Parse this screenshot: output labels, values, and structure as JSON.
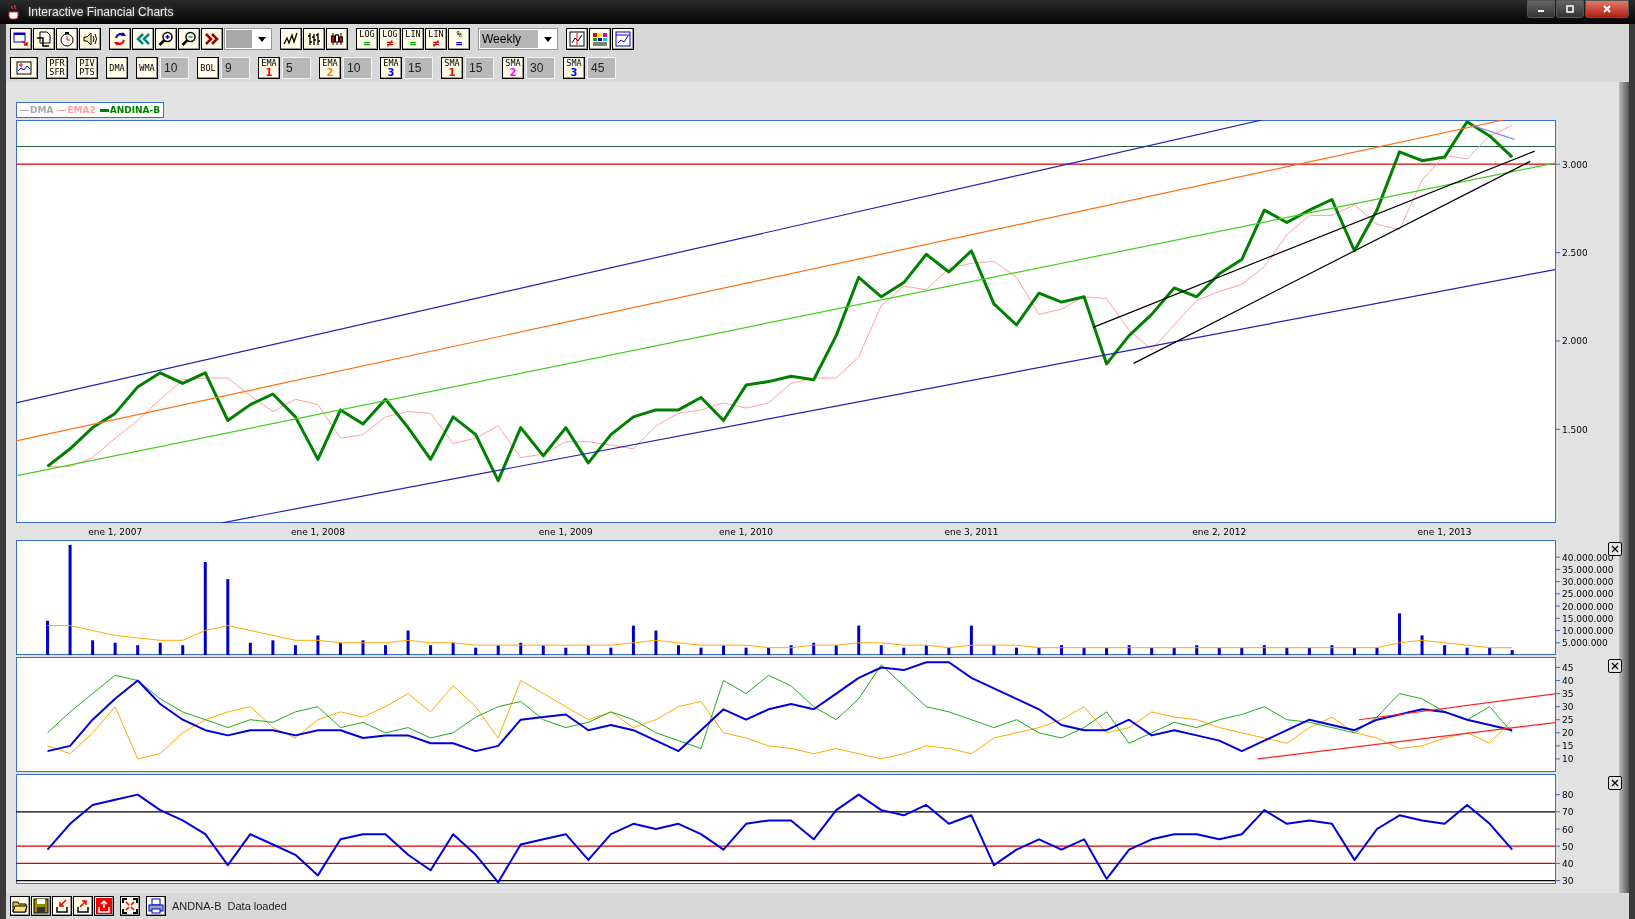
{
  "window": {
    "title": "Interactive Financial Charts"
  },
  "toolbar": {
    "interval": "Weekly",
    "scale_buttons": [
      {
        "label": "LOG",
        "sign": "=",
        "color": "#00a000"
      },
      {
        "label": "LOG",
        "sign": "≠",
        "color": "#e00000"
      },
      {
        "label": "LIN",
        "sign": "=",
        "color": "#00a000"
      },
      {
        "label": "LIN",
        "sign": "≠",
        "color": "#e00000"
      },
      {
        "label": "%",
        "sign": "=",
        "color": "#0000ff"
      }
    ]
  },
  "indicator_bar": {
    "buttons": [
      {
        "kind": "pair",
        "label": "PFR",
        "sub": "SFR"
      },
      {
        "kind": "pair",
        "label": "PIV",
        "sub": "PTS"
      },
      {
        "kind": "single",
        "label": "DMA"
      },
      {
        "kind": "single",
        "label": "WMA",
        "value": "10"
      },
      {
        "kind": "single",
        "label": "BOL",
        "value": "9"
      },
      {
        "kind": "numbered",
        "label": "EMA",
        "sub": "1",
        "color": "#ff0000",
        "value": "5"
      },
      {
        "kind": "numbered",
        "label": "EMA",
        "sub": "2",
        "color": "#ff8000",
        "value": "10"
      },
      {
        "kind": "numbered",
        "label": "EMA",
        "sub": "3",
        "color": "#0000ff",
        "value": "15"
      },
      {
        "kind": "numbered",
        "label": "SMA",
        "sub": "1",
        "color": "#ff0000",
        "value": "15"
      },
      {
        "kind": "numbered",
        "label": "SMA",
        "sub": "2",
        "color": "#ff00ff",
        "value": "30"
      },
      {
        "kind": "numbered",
        "label": "SMA",
        "sub": "3",
        "color": "#0000ff",
        "value": "45"
      }
    ]
  },
  "legend": [
    {
      "label": "DMA",
      "color": "#a8a8a8"
    },
    {
      "label": "EMA2",
      "color": "#ffa0a0"
    },
    {
      "label": "ANDINA-B",
      "color": "#008000"
    }
  ],
  "panels": [
    {
      "closable": false,
      "chart_data": {
        "type": "line",
        "ylim": [
          970,
          3250
        ],
        "categories": [
          null,
          null,
          null,
          "ene 1, 2007",
          null,
          null,
          null,
          null,
          null,
          null,
          null,
          null,
          "ene 1, 2008",
          null,
          null,
          null,
          null,
          null,
          null,
          null,
          null,
          null,
          null,
          "ene 1, 2009",
          null,
          null,
          null,
          null,
          null,
          null,
          null,
          "ene 1, 2010",
          null,
          null,
          null,
          null,
          null,
          null,
          null,
          null,
          null,
          "ene 3, 2011",
          null,
          null,
          null,
          null,
          null,
          null,
          null,
          null,
          null,
          null,
          "ene 2, 2012",
          null,
          null,
          null,
          null,
          null,
          null,
          null,
          null,
          null,
          "ene 1, 2013",
          null,
          null,
          null
        ],
        "yticks": [
          {
            "value": 3000,
            "label": "3.000"
          },
          {
            "value": 2500,
            "label": "2.500"
          },
          {
            "value": 2000,
            "label": "2.000"
          },
          {
            "value": 1500,
            "label": "1.500"
          }
        ],
        "series": [
          {
            "color": "#ffa0a0",
            "values": [
              1290,
              1290,
              1340,
              1450,
              1550,
              1670,
              1780,
              1790,
              1790,
              1690,
              1600,
              1670,
              1640,
              1450,
              1470,
              1570,
              1600,
              1590,
              1420,
              1450,
              1520,
              1340,
              1360,
              1430,
              1430,
              1410,
              1390,
              1520,
              1590,
              1610,
              1650,
              1620,
              1650,
              1760,
              1790,
              1790,
              1910,
              2200,
              2310,
              2290,
              2410,
              2440,
              2450,
              2360,
              2150,
              2180,
              2250,
              2240,
              2060,
              1950,
              2090,
              2230,
              2280,
              2320,
              2420,
              2600,
              2710,
              2710,
              2770,
              2660,
              2630,
              2910,
              3050,
              3030,
              3160,
              3220
            ]
          },
          {
            "color": "#008000",
            "values": [
              1290,
              1390,
              1510,
              1590,
              1740,
              1820,
              1760,
              1820,
              1550,
              1640,
              1700,
              1570,
              1330,
              1610,
              1530,
              1670,
              1510,
              1330,
              1570,
              1470,
              1210,
              1510,
              1350,
              1510,
              1310,
              1470,
              1570,
              1610,
              1610,
              1680,
              1550,
              1750,
              1770,
              1800,
              1780,
              2030,
              2360,
              2250,
              2330,
              2490,
              2390,
              2510,
              2210,
              2090,
              2270,
              2220,
              2250,
              1870,
              2030,
              2150,
              2300,
              2250,
              2380,
              2460,
              2740,
              2670,
              2740,
              2800,
              2510,
              2740,
              3070,
              3020,
              3040,
              3240,
              3160,
              3040
            ]
          }
        ],
        "ref_lines": [
          {
            "axis": "y",
            "value": 3100
          },
          {
            "axis": "y",
            "value": 3000
          }
        ]
      }
    },
    {
      "closable": true,
      "chart_data": {
        "type": "bar",
        "ylim": [
          0,
          47000000
        ],
        "categories": [
          null,
          null,
          null,
          null,
          null,
          null,
          null,
          null,
          null,
          null,
          null,
          null,
          null,
          null,
          null,
          null,
          null,
          null,
          null,
          null,
          null,
          null,
          null,
          null,
          null,
          null,
          null,
          null,
          null,
          null,
          null,
          null,
          null,
          null,
          null,
          null,
          null,
          null,
          null,
          null,
          null,
          null,
          null,
          null,
          null,
          null,
          null,
          null,
          null,
          null,
          null,
          null,
          null,
          null,
          null,
          null,
          null,
          null,
          null,
          null,
          null,
          null,
          null,
          null,
          null,
          null
        ],
        "yticks": [
          {
            "value": 40000000,
            "label": "40.000.000"
          },
          {
            "value": 35000000,
            "label": "35.000.000"
          },
          {
            "value": 30000000,
            "label": "30.000.000"
          },
          {
            "value": 25000000,
            "label": "25.000.000"
          },
          {
            "value": 20000000,
            "label": "20.000.000"
          },
          {
            "value": 15000000,
            "label": "15.000.000"
          },
          {
            "value": 10000000,
            "label": "10.000.000"
          },
          {
            "value": 5000000,
            "label": "5.000.000"
          }
        ],
        "series": [
          {
            "color": "#0000cc",
            "values": [
              14000000,
              45000000,
              6000000,
              5000000,
              4000000,
              5000000,
              4000000,
              38000000,
              31000000,
              5000000,
              6000000,
              4000000,
              8000000,
              5000000,
              6000000,
              4000000,
              10000000,
              4000000,
              5000000,
              3000000,
              4000000,
              5000000,
              4000000,
              3000000,
              4000000,
              3000000,
              12000000,
              10000000,
              4000000,
              3000000,
              4000000,
              3000000,
              3000000,
              4000000,
              5000000,
              4000000,
              12000000,
              4000000,
              3000000,
              4000000,
              3000000,
              12000000,
              4000000,
              3000000,
              3000000,
              4000000,
              3000000,
              3000000,
              4000000,
              3000000,
              3000000,
              4000000,
              3000000,
              3000000,
              4000000,
              3000000,
              3000000,
              4000000,
              3000000,
              3000000,
              17000000,
              8000000,
              4000000,
              3000000,
              3000000,
              2000000
            ]
          },
          {
            "type": "line",
            "color": "#ffaa00",
            "values": [
              12000000,
              12000000,
              10000000,
              8000000,
              7000000,
              6000000,
              6000000,
              10000000,
              12000000,
              10000000,
              8000000,
              6000000,
              6000000,
              5000000,
              5000000,
              5000000,
              6000000,
              5000000,
              5000000,
              4000000,
              4000000,
              4000000,
              4000000,
              4000000,
              4000000,
              4000000,
              5000000,
              6000000,
              5000000,
              4000000,
              4000000,
              4000000,
              3000000,
              3000000,
              4000000,
              4000000,
              5000000,
              5000000,
              4000000,
              4000000,
              3000000,
              4000000,
              4000000,
              4000000,
              3000000,
              3000000,
              3000000,
              3000000,
              3000000,
              3000000,
              3000000,
              3000000,
              3000000,
              3000000,
              3000000,
              3000000,
              3000000,
              3000000,
              3000000,
              3000000,
              5000000,
              6000000,
              5000000,
              4000000,
              3000000,
              3000000
            ]
          }
        ]
      }
    },
    {
      "closable": true,
      "chart_data": {
        "type": "line",
        "ylim": [
          5,
          49
        ],
        "categories": [
          null,
          null,
          null,
          null,
          null,
          null,
          null,
          null,
          null,
          null,
          null,
          null,
          null,
          null,
          null,
          null,
          null,
          null,
          null,
          null,
          null,
          null,
          null,
          null,
          null,
          null,
          null,
          null,
          null,
          null,
          null,
          null,
          null,
          null,
          null,
          null,
          null,
          null,
          null,
          null,
          null,
          null,
          null,
          null,
          null,
          null,
          null,
          null,
          null,
          null,
          null,
          null,
          null,
          null,
          null,
          null,
          null,
          null,
          null,
          null,
          null,
          null,
          null,
          null,
          null,
          null
        ],
        "yticks": [
          45,
          40,
          35,
          30,
          25,
          20,
          15,
          10
        ],
        "series": [
          {
            "color": "#ffaa00",
            "values": [
              15,
              12,
              20,
              30,
              10,
              12,
              20,
              25,
              28,
              30,
              22,
              18,
              25,
              28,
              26,
              30,
              35,
              28,
              38,
              30,
              18,
              40,
              35,
              30,
              25,
              28,
              22,
              25,
              30,
              32,
              20,
              18,
              15,
              14,
              12,
              14,
              12,
              10,
              12,
              15,
              14,
              12,
              18,
              20,
              22,
              25,
              30,
              20,
              22,
              28,
              26,
              25,
              22,
              20,
              18,
              16,
              22,
              26,
              20,
              18,
              14,
              15,
              18,
              20,
              16,
              25
            ]
          },
          {
            "color": "#22aa22",
            "values": [
              20,
              28,
              35,
              42,
              40,
              33,
              28,
              25,
              22,
              25,
              24,
              28,
              30,
              22,
              24,
              20,
              22,
              18,
              20,
              26,
              30,
              32,
              25,
              22,
              24,
              28,
              25,
              20,
              17,
              14,
              40,
              35,
              42,
              38,
              30,
              25,
              33,
              46,
              38,
              30,
              28,
              25,
              22,
              25,
              20,
              18,
              22,
              28,
              16,
              20,
              24,
              22,
              25,
              27,
              30,
              25,
              24,
              22,
              20,
              26,
              35,
              33,
              28,
              25,
              30,
              20
            ]
          },
          {
            "color": "#0000dd",
            "values": [
              13,
              15,
              25,
              33,
              40,
              31,
              25,
              21,
              19,
              21,
              21,
              19,
              21,
              21,
              18,
              19,
              19,
              16,
              16,
              13,
              15,
              25,
              26,
              27,
              21,
              23,
              21,
              17,
              13,
              21,
              29,
              25,
              29,
              31,
              29,
              35,
              41,
              45,
              44,
              47,
              47,
              41,
              37,
              33,
              29,
              23,
              21,
              21,
              25,
              19,
              21,
              19,
              17,
              13,
              17,
              21,
              25,
              23,
              21,
              25,
              27,
              29,
              28,
              25,
              23,
              21
            ]
          }
        ]
      }
    },
    {
      "closable": true,
      "chart_data": {
        "type": "line",
        "ylim": [
          28,
          92
        ],
        "categories": [
          null,
          null,
          null,
          null,
          null,
          null,
          null,
          null,
          null,
          null,
          null,
          null,
          null,
          null,
          null,
          null,
          null,
          null,
          null,
          null,
          null,
          null,
          null,
          null,
          null,
          null,
          null,
          null,
          null,
          null,
          null,
          null,
          null,
          null,
          null,
          null,
          null,
          null,
          null,
          null,
          null,
          null,
          null,
          null,
          null,
          null,
          null,
          null,
          null,
          null,
          null,
          null,
          null,
          null,
          null,
          null,
          null,
          null,
          null,
          null,
          null,
          null,
          null,
          null,
          null,
          null
        ],
        "yticks": [
          80,
          70,
          60,
          50,
          40,
          30
        ],
        "series": [
          {
            "color": "#0000dd",
            "values": [
              48,
              63,
              74,
              77,
              80,
              71,
              65,
              57,
              39,
              57,
              51,
              45,
              33,
              54,
              57,
              57,
              45,
              36,
              57,
              45,
              29,
              51,
              54,
              57,
              42,
              57,
              63,
              60,
              63,
              57,
              48,
              63,
              65,
              65,
              54,
              71,
              80,
              71,
              68,
              74,
              63,
              68,
              39,
              48,
              54,
              48,
              54,
              31,
              48,
              54,
              57,
              57,
              54,
              57,
              71,
              63,
              65,
              63,
              42,
              60,
              68,
              65,
              63,
              74,
              63,
              48
            ]
          }
        ],
        "ref_lines": [
          {
            "axis": "y",
            "value": 70
          },
          {
            "axis": "y",
            "value": 50
          },
          {
            "axis": "y",
            "value": 40
          },
          {
            "axis": "y",
            "value": 30
          }
        ]
      }
    }
  ],
  "status_bar": {
    "symbol": "ANDNA-B",
    "message": "Data loaded"
  }
}
